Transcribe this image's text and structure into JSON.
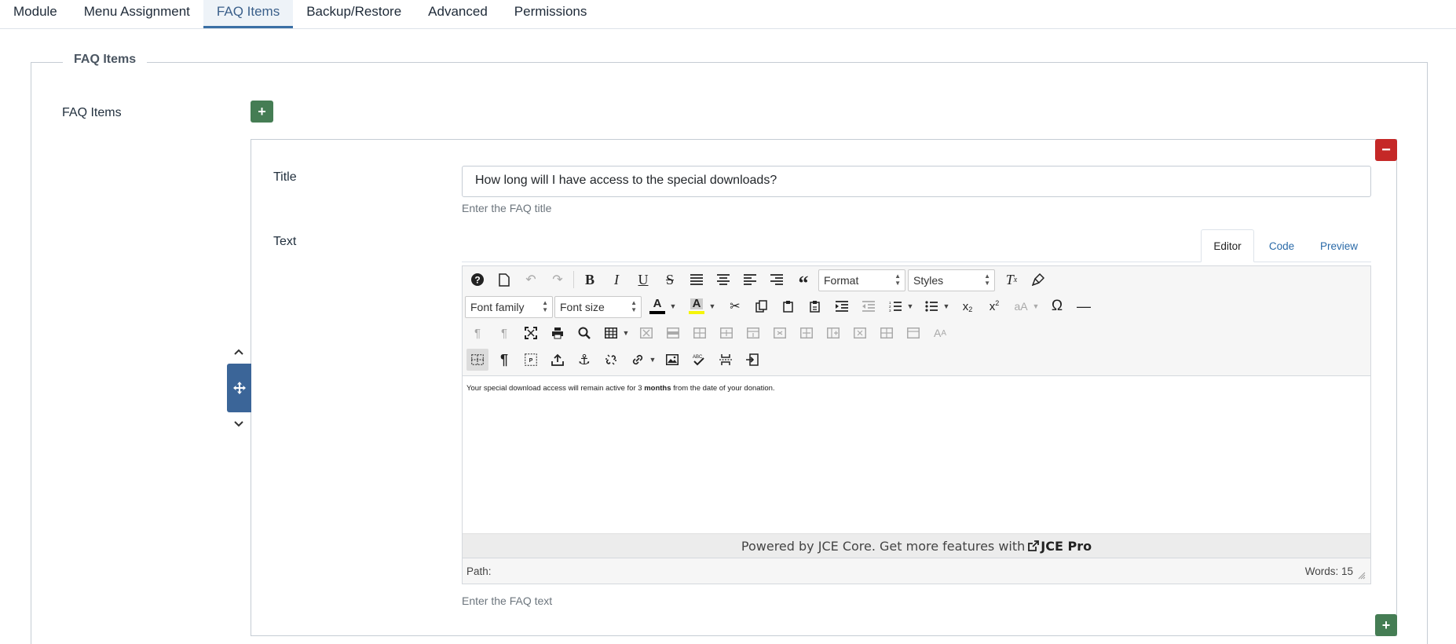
{
  "tabs": [
    {
      "label": "Module"
    },
    {
      "label": "Menu Assignment"
    },
    {
      "label": "FAQ Items",
      "active": true
    },
    {
      "label": "Backup/Restore"
    },
    {
      "label": "Advanced"
    },
    {
      "label": "Permissions"
    }
  ],
  "fieldset": {
    "legend": "FAQ Items",
    "label": "FAQ Items"
  },
  "item": {
    "title_label": "Title",
    "title_value": "How long will I have access to the special downloads?",
    "title_hint": "Enter the FAQ title",
    "text_label": "Text",
    "text_hint": "Enter the FAQ text"
  },
  "editor": {
    "tabs": [
      "Editor",
      "Code",
      "Preview"
    ],
    "format_label": "Format",
    "styles_label": "Styles",
    "font_family_label": "Font family",
    "font_size_label": "Font size",
    "content": {
      "before": "Your special download access will remain active for 3 ",
      "bold": "months",
      "after": " from the date of your donation."
    },
    "powered_text": "Powered by JCE Core. Get more features with",
    "powered_link": "JCE Pro",
    "path_label": "Path:",
    "word_count": "Words: 15"
  },
  "colors": {
    "accent": "#3a6fa5",
    "add": "#457d54",
    "remove": "#c52827"
  }
}
